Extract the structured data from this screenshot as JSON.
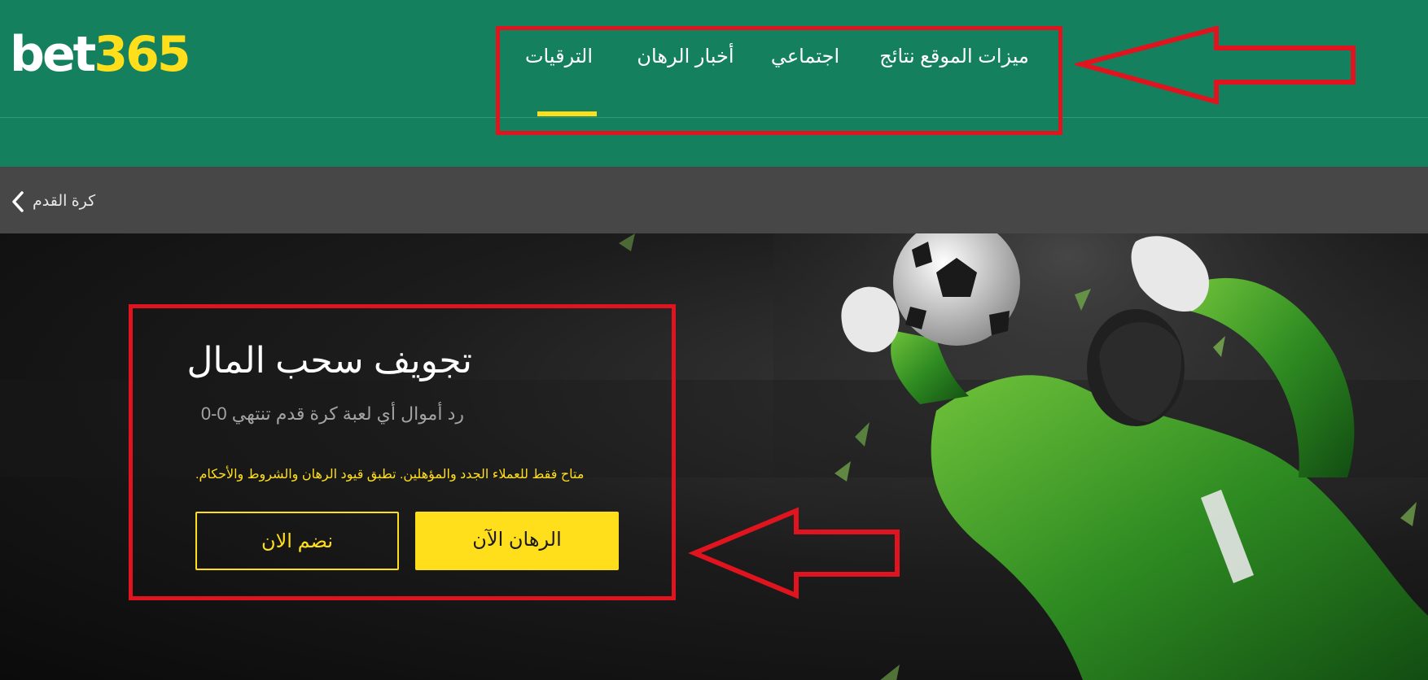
{
  "header": {
    "logo": {
      "part1": "bet",
      "part2": "365"
    },
    "nav": [
      {
        "label": "الترقيات",
        "active": true
      },
      {
        "label": "أخبار الرهان"
      },
      {
        "label": "اجتماعي"
      },
      {
        "label": "نتائج"
      },
      {
        "label": "ميزات الموقع"
      }
    ]
  },
  "breadcrumb": {
    "label": "كرة القدم",
    "icon": "chevron-left-icon"
  },
  "promo": {
    "title": "تجويف سحب المال",
    "subtitle": "رد أموال أي لعبة كرة قدم تنتهي 0-0",
    "terms": "متاح فقط للعملاء الجدد والمؤهلين. تطبق قيود الرهان والشروط والأحكام.",
    "join_label": "نضم الان",
    "bet_label": "الرهان الآن"
  },
  "colors": {
    "header_green": "#14805e",
    "brand_yellow": "#ffdf1b",
    "crumb_grey": "#474747",
    "annotation_red": "#e0141e"
  }
}
